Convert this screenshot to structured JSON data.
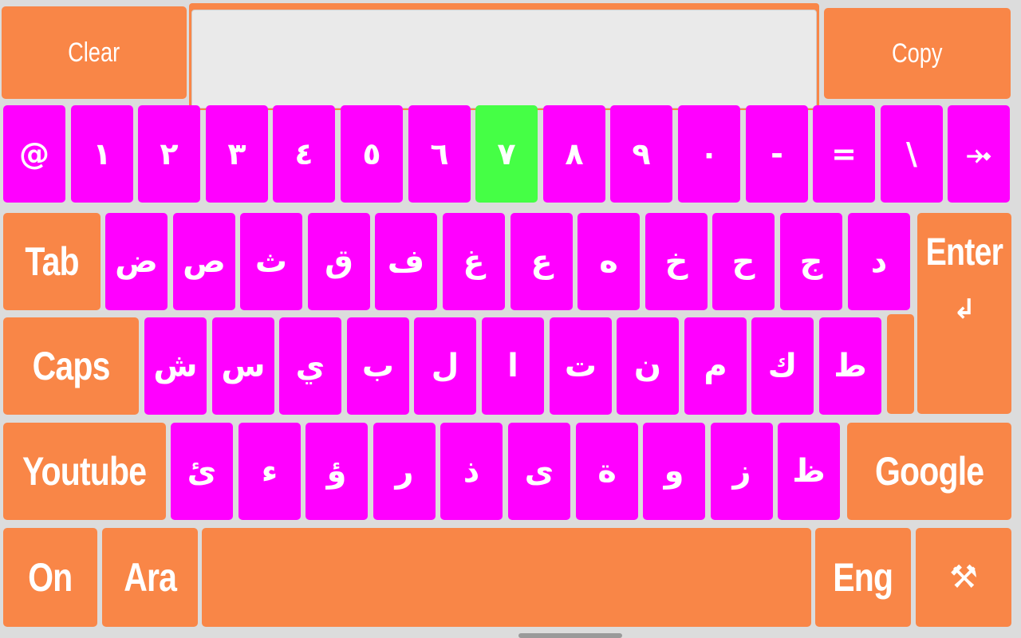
{
  "top": {
    "clear_label": "Clear",
    "copy_label": "Copy",
    "text_value": ""
  },
  "row1": [
    "@",
    "١",
    "٢",
    "٣",
    "٤",
    "٥",
    "٦",
    "٧",
    "٨",
    "٩",
    "٠",
    "-",
    "=",
    "\\",
    "⤞"
  ],
  "row1_active_index": 7,
  "row2": {
    "tab_label": "Tab",
    "keys": [
      "ض",
      "ص",
      "ث",
      "ق",
      "ف",
      "غ",
      "ع",
      "ه",
      "خ",
      "ح",
      "ج",
      "د"
    ],
    "enter_label": "Enter",
    "enter_symbol": "↲"
  },
  "row3": {
    "caps_label": "Caps",
    "keys": [
      "ش",
      "س",
      "ي",
      "ب",
      "ل",
      "ا",
      "ت",
      "ن",
      "م",
      "ك",
      "ط"
    ]
  },
  "row4": {
    "youtube_label": "Youtube",
    "keys": [
      "ئ",
      "ء",
      "ؤ",
      "ر",
      "ذ",
      "ى",
      "ة",
      "و",
      "ز",
      "ظ"
    ],
    "google_label": "Google"
  },
  "row5": {
    "on_label": "On",
    "ara_label": "Ara",
    "space_label": "",
    "eng_label": "Eng",
    "tools_symbol": "⚒"
  },
  "colors": {
    "function_key": "#f98647",
    "letter_key": "#ff00ff",
    "active_key": "#45ff45"
  }
}
